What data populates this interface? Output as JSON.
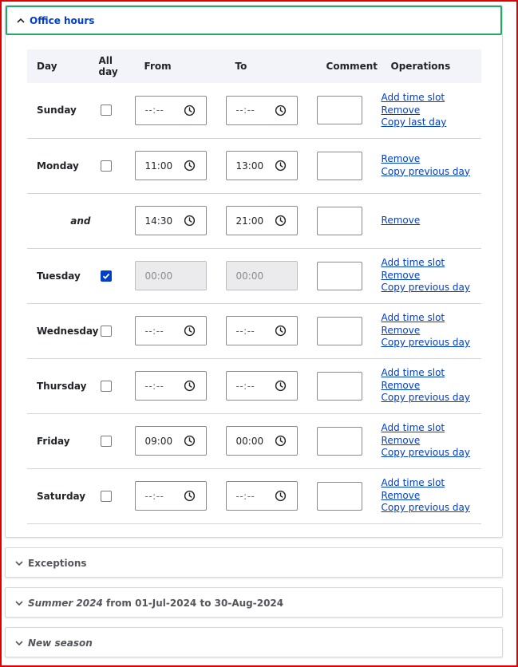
{
  "office_hours": {
    "title": "Office hours",
    "columns": {
      "day": "Day",
      "all_day": "All day",
      "from": "From",
      "to": "To",
      "comment": "Comment",
      "operations": "Operations"
    },
    "rows": [
      {
        "day": "Sunday",
        "all_day": false,
        "from": "--:--",
        "to": "--:--",
        "ops": [
          "Add time slot",
          "Remove",
          "Copy last day"
        ]
      },
      {
        "day": "Monday",
        "all_day": false,
        "from": "11:00",
        "to": "13:00",
        "ops": [
          "Remove",
          "Copy previous day"
        ]
      },
      {
        "day": "and",
        "is_slot": true,
        "from": "14:30",
        "to": "21:00",
        "ops": [
          "Remove"
        ]
      },
      {
        "day": "Tuesday",
        "all_day": true,
        "from": "00:00",
        "to": "00:00",
        "ops": [
          "Add time slot",
          "Remove",
          "Copy previous day"
        ]
      },
      {
        "day": "Wednesday",
        "all_day": false,
        "from": "--:--",
        "to": "--:--",
        "ops": [
          "Add time slot",
          "Remove",
          "Copy previous day"
        ]
      },
      {
        "day": "Thursday",
        "all_day": false,
        "from": "--:--",
        "to": "--:--",
        "ops": [
          "Add time slot",
          "Remove",
          "Copy previous day"
        ]
      },
      {
        "day": "Friday",
        "all_day": false,
        "from": "09:00",
        "to": "00:00",
        "ops": [
          "Add time slot",
          "Remove",
          "Copy previous day"
        ]
      },
      {
        "day": "Saturday",
        "all_day": false,
        "from": "--:--",
        "to": "--:--",
        "ops": [
          "Add time slot",
          "Remove",
          "Copy previous day"
        ]
      }
    ]
  },
  "sections": {
    "exceptions": "Exceptions",
    "summer": {
      "name": "Summer 2024",
      "from_word": "from",
      "start": "01-Jul-2024",
      "to_word": "to",
      "end": "30-Aug-2024"
    },
    "new_season": "New season"
  },
  "colors": {
    "link": "#003ecc",
    "focus_border": "#26a769",
    "frame_border": "#e00000",
    "header_bg": "#f3f4f9"
  },
  "icons": {
    "expanded": "chevron-up-icon",
    "collapsed": "chevron-down-icon",
    "time": "clock-icon",
    "checked": "checkmark-icon"
  }
}
